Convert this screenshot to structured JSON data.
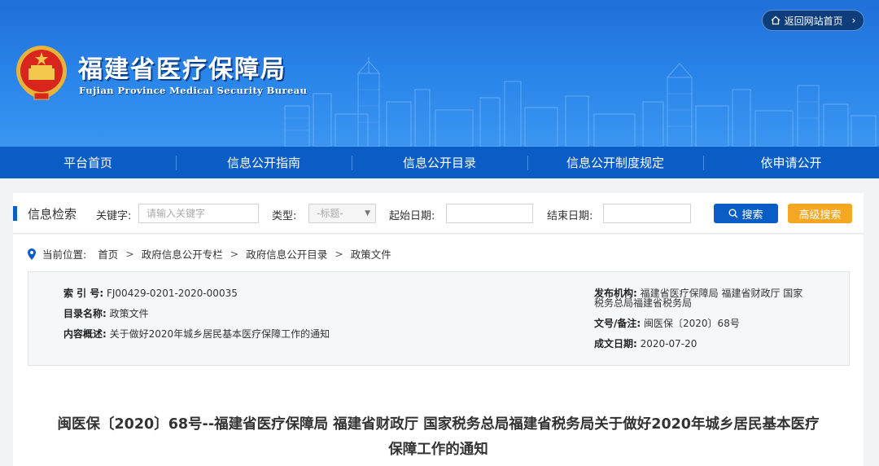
{
  "header": {
    "title": "福建省医疗保障局",
    "subtitle": "Fujian Province Medical Security Bureau",
    "home_link": "返回网站首页"
  },
  "nav": {
    "items": [
      "平台首页",
      "信息公开指南",
      "信息公开目录",
      "信息公开制度规定",
      "依申请公开"
    ]
  },
  "search": {
    "title": "信息检索",
    "keyword_label": "关键字:",
    "keyword_placeholder": "请输入关键字",
    "type_label": "类型:",
    "type_value": "-标题-",
    "start_label": "起始日期:",
    "end_label": "结束日期:",
    "search_button": "搜索",
    "advanced_button": "高级搜索"
  },
  "breadcrumb": {
    "prefix": "当前位置:",
    "items": [
      "首页",
      "政府信息公开专栏",
      "政府信息公开目录",
      "政策文件"
    ]
  },
  "meta": {
    "index_label": "索 引 号:",
    "index_value": "FJ00429-0201-2020-00035",
    "category_label": "目录名称:",
    "category_value": "政策文件",
    "summary_label": "内容概述:",
    "summary_value": "关于做好2020年城乡居民基本医疗保障工作的通知",
    "publisher_label": "发布机构:",
    "publisher_value_1": "福建省医疗保障局 福建省财政厅 国家",
    "publisher_value_2": "税务总局福建省税务局",
    "docno_label": "文号/备注:",
    "docno_value": "闽医保〔2020〕68号",
    "date_label": "成文日期:",
    "date_value": "2020-07-20"
  },
  "document": {
    "title_line1": "闽医保〔2020〕68号--福建省医疗保障局 福建省财政厅 国家税务总局福建省税务局关于做好2020年城乡居民基本医疗",
    "title_line2": "保障工作的通知"
  },
  "colors": {
    "banner": "#2b86ea",
    "nav": "#0a5dc4",
    "accent_orange": "#f5a623"
  }
}
